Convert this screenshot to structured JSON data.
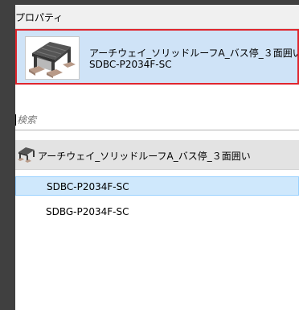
{
  "panel": {
    "title": "プロパティ"
  },
  "type_selector": {
    "family_name": "アーチウェイ_ソリッドルーフA_バス停_３面囲い",
    "type_name": "SDBC-P2034F-SC",
    "thumbnail_icon": "bus-shelter-thumbnail-icon"
  },
  "search": {
    "placeholder": "検索",
    "value": ""
  },
  "list": {
    "group": {
      "label": "アーチウェイ_ソリッドルーフA_バス停_３面囲い",
      "icon": "bus-shelter-icon"
    },
    "items": [
      {
        "label": "SDBC-P2034F-SC",
        "selected": true
      },
      {
        "label": "SDBG-P2034F-SC",
        "selected": false
      }
    ]
  },
  "colors": {
    "selector_highlight": "#cfe3f7",
    "selector_border": "#e0262e",
    "selected_row": "#cfe8fc",
    "selected_row_border": "#99d1ff",
    "group_header": "#e3e3e3"
  }
}
